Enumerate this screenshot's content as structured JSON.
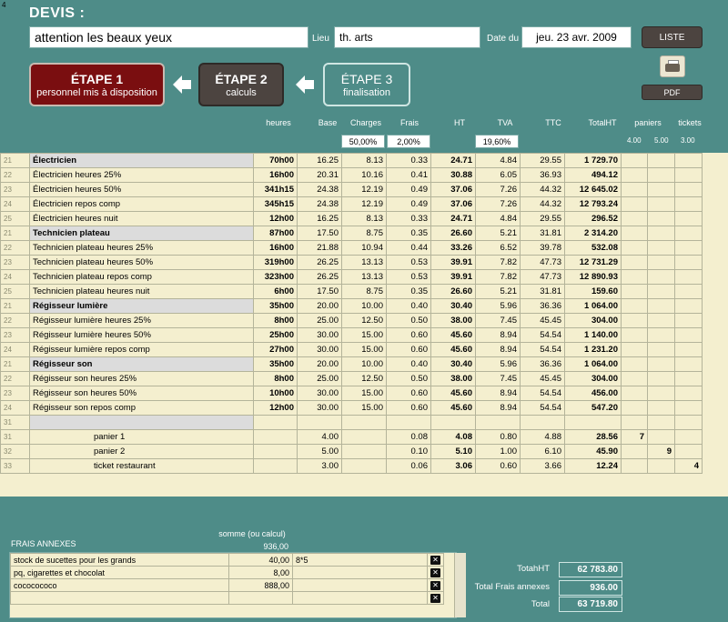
{
  "corner_number": "4",
  "header": {
    "title": "DEVIS :",
    "devis_name": "attention les beaux yeux",
    "lieu_label": "Lieu",
    "lieu_value": "th. arts",
    "date_label": "Date du",
    "date_value": "jeu. 23 avr. 2009",
    "liste_label": "LISTE",
    "pdf_label": "PDF"
  },
  "steps": [
    {
      "title": "ÉTAPE 1",
      "sub": "personnel mis à disposition"
    },
    {
      "title": "ÉTAPE 2",
      "sub": "calculs"
    },
    {
      "title": "ÉTAPE 3",
      "sub": "finalisation"
    }
  ],
  "columns": {
    "heures": "heures",
    "base": "Base",
    "charges": "Charges",
    "frais": "Frais",
    "ht": "HT",
    "tva": "TVA",
    "ttc": "TTC",
    "totalht": "TotalHT",
    "paniers": "paniers",
    "tickets": "tickets"
  },
  "rates": {
    "charges": "50,00%",
    "frais": "2,00%",
    "tva": "19,60%"
  },
  "unit_prices": {
    "panier1": "4.00",
    "panier2": "5.00",
    "ticket": "3.00"
  },
  "rows": [
    {
      "n": "21",
      "label": "Électricien",
      "heures": "70h00",
      "base": "16.25",
      "charges": "8.13",
      "frais": "0.33",
      "ht": "24.71",
      "tva": "4.84",
      "ttc": "29.55",
      "totalht": "1 729.70",
      "cat": true
    },
    {
      "n": "22",
      "label": "Électricien heures 25%",
      "heures": "16h00",
      "base": "20.31",
      "charges": "10.16",
      "frais": "0.41",
      "ht": "30.88",
      "tva": "6.05",
      "ttc": "36.93",
      "totalht": "494.12"
    },
    {
      "n": "23",
      "label": "Électricien heures 50%",
      "heures": "341h15",
      "base": "24.38",
      "charges": "12.19",
      "frais": "0.49",
      "ht": "37.06",
      "tva": "7.26",
      "ttc": "44.32",
      "totalht": "12 645.02"
    },
    {
      "n": "24",
      "label": "Électricien repos comp",
      "heures": "345h15",
      "base": "24.38",
      "charges": "12.19",
      "frais": "0.49",
      "ht": "37.06",
      "tva": "7.26",
      "ttc": "44.32",
      "totalht": "12 793.24"
    },
    {
      "n": "25",
      "label": "Électricien heures nuit",
      "heures": "12h00",
      "base": "16.25",
      "charges": "8.13",
      "frais": "0.33",
      "ht": "24.71",
      "tva": "4.84",
      "ttc": "29.55",
      "totalht": "296.52"
    },
    {
      "n": "21",
      "label": "Technicien plateau",
      "heures": "87h00",
      "base": "17.50",
      "charges": "8.75",
      "frais": "0.35",
      "ht": "26.60",
      "tva": "5.21",
      "ttc": "31.81",
      "totalht": "2 314.20",
      "cat": true
    },
    {
      "n": "22",
      "label": "Technicien plateau heures 25%",
      "heures": "16h00",
      "base": "21.88",
      "charges": "10.94",
      "frais": "0.44",
      "ht": "33.26",
      "tva": "6.52",
      "ttc": "39.78",
      "totalht": "532.08"
    },
    {
      "n": "23",
      "label": "Technicien plateau heures 50%",
      "heures": "319h00",
      "base": "26.25",
      "charges": "13.13",
      "frais": "0.53",
      "ht": "39.91",
      "tva": "7.82",
      "ttc": "47.73",
      "totalht": "12 731.29"
    },
    {
      "n": "24",
      "label": "Technicien plateau repos comp",
      "heures": "323h00",
      "base": "26.25",
      "charges": "13.13",
      "frais": "0.53",
      "ht": "39.91",
      "tva": "7.82",
      "ttc": "47.73",
      "totalht": "12 890.93"
    },
    {
      "n": "25",
      "label": "Technicien plateau heures nuit",
      "heures": "6h00",
      "base": "17.50",
      "charges": "8.75",
      "frais": "0.35",
      "ht": "26.60",
      "tva": "5.21",
      "ttc": "31.81",
      "totalht": "159.60"
    },
    {
      "n": "21",
      "label": "Régisseur lumière",
      "heures": "35h00",
      "base": "20.00",
      "charges": "10.00",
      "frais": "0.40",
      "ht": "30.40",
      "tva": "5.96",
      "ttc": "36.36",
      "totalht": "1 064.00",
      "cat": true
    },
    {
      "n": "22",
      "label": "Régisseur lumière heures 25%",
      "heures": "8h00",
      "base": "25.00",
      "charges": "12.50",
      "frais": "0.50",
      "ht": "38.00",
      "tva": "7.45",
      "ttc": "45.45",
      "totalht": "304.00"
    },
    {
      "n": "23",
      "label": "Régisseur lumière heures 50%",
      "heures": "25h00",
      "base": "30.00",
      "charges": "15.00",
      "frais": "0.60",
      "ht": "45.60",
      "tva": "8.94",
      "ttc": "54.54",
      "totalht": "1 140.00"
    },
    {
      "n": "24",
      "label": "Régisseur lumière repos comp",
      "heures": "27h00",
      "base": "30.00",
      "charges": "15.00",
      "frais": "0.60",
      "ht": "45.60",
      "tva": "8.94",
      "ttc": "54.54",
      "totalht": "1 231.20"
    },
    {
      "n": "21",
      "label": "Régisseur son",
      "heures": "35h00",
      "base": "20.00",
      "charges": "10.00",
      "frais": "0.40",
      "ht": "30.40",
      "tva": "5.96",
      "ttc": "36.36",
      "totalht": "1 064.00",
      "cat": true
    },
    {
      "n": "22",
      "label": "Régisseur son heures 25%",
      "heures": "8h00",
      "base": "25.00",
      "charges": "12.50",
      "frais": "0.50",
      "ht": "38.00",
      "tva": "7.45",
      "ttc": "45.45",
      "totalht": "304.00"
    },
    {
      "n": "23",
      "label": "Régisseur son heures 50%",
      "heures": "10h00",
      "base": "30.00",
      "charges": "15.00",
      "frais": "0.60",
      "ht": "45.60",
      "tva": "8.94",
      "ttc": "54.54",
      "totalht": "456.00"
    },
    {
      "n": "24",
      "label": "Régisseur son repos comp",
      "heures": "12h00",
      "base": "30.00",
      "charges": "15.00",
      "frais": "0.60",
      "ht": "45.60",
      "tva": "8.94",
      "ttc": "54.54",
      "totalht": "547.20"
    },
    {
      "n": "31",
      "label": "",
      "heures": "",
      "base": "",
      "charges": "",
      "frais": "",
      "ht": "",
      "tva": "",
      "ttc": "",
      "totalht": "",
      "cat": true
    },
    {
      "n": "31",
      "label": "panier 1",
      "heures": "",
      "base": "4.00",
      "charges": "",
      "frais": "0.08",
      "ht": "4.08",
      "tva": "0.80",
      "ttc": "4.88",
      "totalht": "28.56",
      "indent": true,
      "p": "7"
    },
    {
      "n": "32",
      "label": "panier 2",
      "heures": "",
      "base": "5.00",
      "charges": "",
      "frais": "0.10",
      "ht": "5.10",
      "tva": "1.00",
      "ttc": "6.10",
      "totalht": "45.90",
      "indent": true,
      "p2": "9"
    },
    {
      "n": "33",
      "label": "ticket restaurant",
      "heures": "",
      "base": "3.00",
      "charges": "",
      "frais": "0.06",
      "ht": "3.06",
      "tva": "0.60",
      "ttc": "3.66",
      "totalht": "12.24",
      "indent": true,
      "t": "4"
    }
  ],
  "frais_annexes": {
    "title": "FRAIS ANNEXES",
    "somme_header": "somme (ou calcul)",
    "somme_total": "936,00",
    "items": [
      {
        "label": "stock de sucettes pour les grands",
        "somme": "40,00",
        "calc": "8*5"
      },
      {
        "label": "pq, cigarettes et chocolat",
        "somme": "8,00",
        "calc": ""
      },
      {
        "label": "cococococo",
        "somme": "888,00",
        "calc": ""
      },
      {
        "label": "",
        "somme": "",
        "calc": ""
      }
    ]
  },
  "totals": {
    "totalht_label": "TotahHT",
    "totalht_value": "62 783.80",
    "frais_label": "Total Frais annexes",
    "frais_value": "936.00",
    "total_label": "Total",
    "total_value": "63 719.80"
  }
}
